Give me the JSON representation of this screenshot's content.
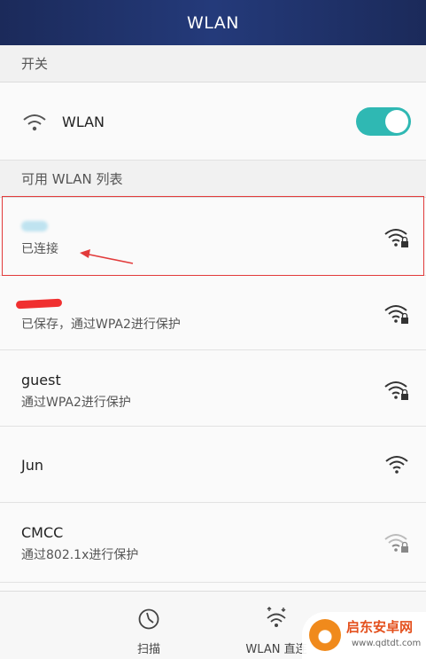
{
  "titlebar": {
    "title": "WLAN"
  },
  "switch_section": {
    "header": "开关",
    "wlan_label": "WLAN",
    "toggle_on": true
  },
  "list_section": {
    "header": "可用 WLAN 列表"
  },
  "networks": [
    {
      "name": "",
      "status": "已连接",
      "secured": true,
      "signal": "full"
    },
    {
      "name": "",
      "status": "已保存，通过WPA2进行保护",
      "secured": true,
      "signal": "full"
    },
    {
      "name": "guest",
      "status": "通过WPA2进行保护",
      "secured": true,
      "signal": "full"
    },
    {
      "name": "Jun",
      "status": "",
      "secured": false,
      "signal": "full"
    },
    {
      "name": "CMCC",
      "status": "通过802.1x进行保护",
      "secured": true,
      "signal": "weak"
    }
  ],
  "bottombar": {
    "scan_label": "扫描",
    "direct_label": "WLAN 直连"
  },
  "watermark": {
    "title": "启东安卓网",
    "url": "www.qdtdt.com"
  },
  "colors": {
    "toggle": "#2fb8b3",
    "title_bar": "#1b2a5a",
    "annotation": "#e23b3b"
  }
}
